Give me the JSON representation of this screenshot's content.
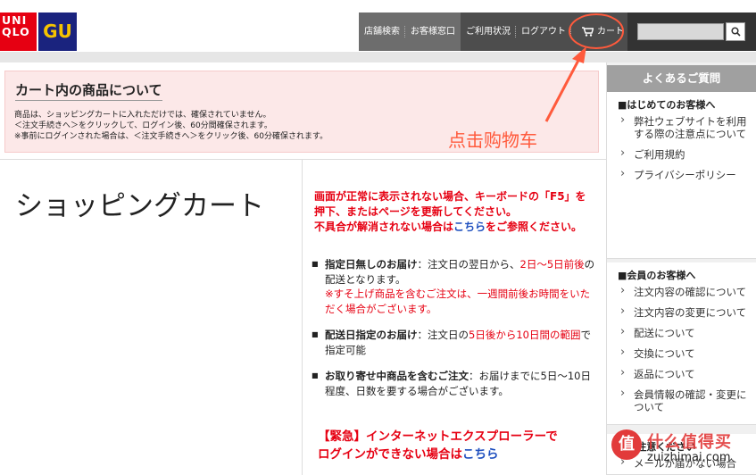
{
  "header": {
    "logo_uniqlo": [
      "UNI",
      "QLO"
    ],
    "logo_gu": "GU",
    "nav": {
      "store_search": "店舗検索",
      "customer_service": "お客様窓口",
      "usage_status": "ご利用状況",
      "logout": "ログアウト",
      "cart": "カート"
    },
    "search": {
      "placeholder": ""
    }
  },
  "notice": {
    "title": "カート内の商品について",
    "lines": [
      "商品は、ショッピングカートに入れただけでは、確保されていません。",
      "＜注文手続きへ＞をクリックして、ログイン後、60分間確保されます。",
      "※事前にログインされた場合は、＜注文手続きへ＞をクリック後、60分確保されます。"
    ]
  },
  "annotation": {
    "text": "点击购物车",
    "color": "#ff5a3c"
  },
  "main": {
    "page_title": "ショッピングカート",
    "warning": {
      "line1": "画面が正常に表示されない場合、キーボードの「F5」を",
      "line2": "押下、またはページを更新してください。",
      "line3_before": "不具合が解消されない場合は",
      "line3_link": "こちら",
      "line3_after": "をご参照ください。"
    },
    "bullets": [
      {
        "label": "指定日無しのお届け",
        "text_a": "：注文日の翌日から、",
        "text_red": "2日〜5日前後",
        "text_b": "の配送となります。",
        "note": "※すそ上げ商品を含むご注文は、一週間前後お時間をいただく場合がございます。"
      },
      {
        "label": "配送日指定のお届け",
        "text_a": "：注文日の",
        "text_red": "5日後から10日間の範囲",
        "text_b": "で指定可能"
      },
      {
        "label": "お取り寄せ中商品を含むご注文",
        "text_a": "：お届けまでに5日〜10日程度、日数を要する場合がございます。"
      }
    ],
    "urgent": {
      "line1": "【緊急】インターネットエクスプローラーで",
      "line2_before": "ログインができない場合は",
      "line2_link": "こちら"
    }
  },
  "sidebar": {
    "title": "よくあるご質問",
    "sections": [
      {
        "title": "■はじめてのお客様へ",
        "links": [
          "弊社ウェブサイトを利用する際の注意点について",
          "ご利用規約",
          "プライバシーポリシー"
        ]
      },
      {
        "title": "■会員のお客様へ",
        "links": [
          "注文内容の確認について",
          "注文内容の変更について",
          "配送について",
          "交換について",
          "返品について",
          "会員情報の確認・変更について"
        ]
      },
      {
        "title": "■ご注意ください",
        "links": [
          "メールが届かない場合"
        ]
      }
    ]
  },
  "watermark": {
    "badge": "值",
    "top": "什么值得买",
    "bottom": "zuizhimai.com"
  },
  "colors": {
    "accent_red": "#e60012",
    "nav_dark": "#4d4d4d",
    "nav_mid": "#6d6d6d",
    "link_blue": "#1e4fbf"
  }
}
